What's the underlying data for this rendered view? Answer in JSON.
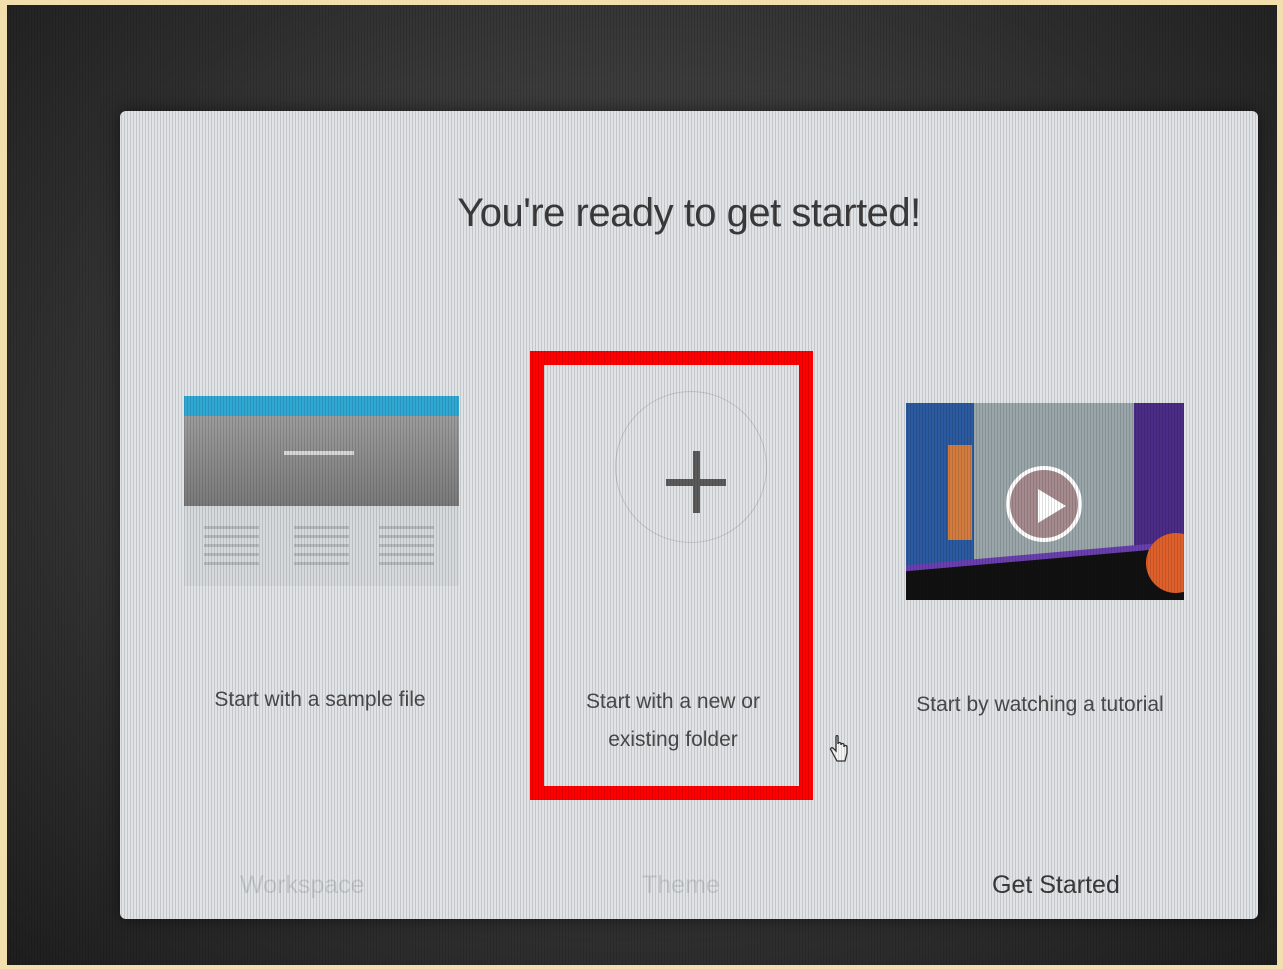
{
  "dialog": {
    "title": "You're ready to get started!"
  },
  "options": [
    {
      "label": "Start with a sample file",
      "thumbnail": "sample-file-preview"
    },
    {
      "label": "Start with a new or existing folder",
      "thumbnail": "plus-icon",
      "highlighted": true
    },
    {
      "label": "Start by watching a tutorial",
      "thumbnail": "video-preview-with-play-icon"
    }
  ],
  "steps": [
    {
      "label": "Workspace",
      "active": false
    },
    {
      "label": "Theme",
      "active": false
    },
    {
      "label": "Get Started",
      "active": true
    }
  ],
  "colors": {
    "highlight_box": "#ff0000",
    "accent_bar": "#2fa9d4",
    "frame": "#f3dfae"
  }
}
